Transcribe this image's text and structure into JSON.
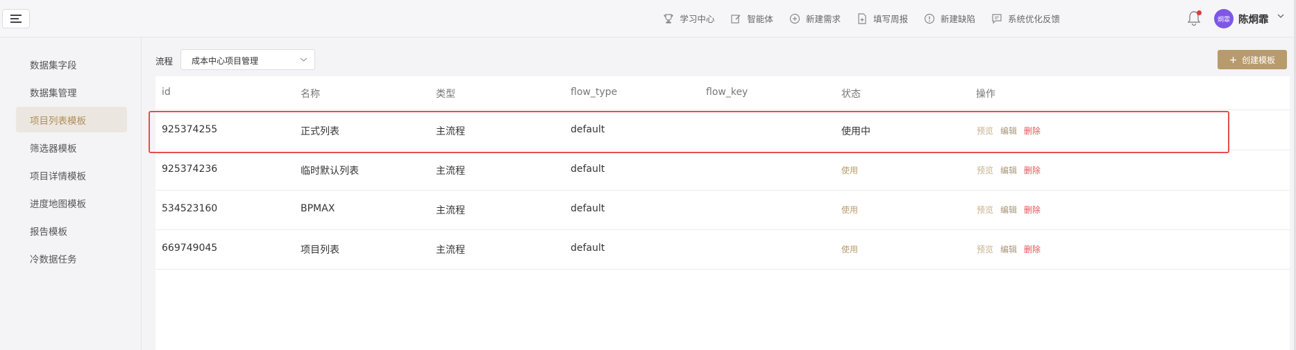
{
  "topbar": {
    "menu_icon": "menu-toggle-icon",
    "actions": [
      {
        "label": "学习中心",
        "icon": "trophy-icon"
      },
      {
        "label": "智能体",
        "icon": "edit-icon"
      },
      {
        "label": "新建需求",
        "icon": "plus-circle-icon"
      },
      {
        "label": "填写周报",
        "icon": "document-icon"
      },
      {
        "label": "新建缺陷",
        "icon": "alert-circle-icon"
      },
      {
        "label": "系统优化反馈",
        "icon": "message-icon"
      }
    ],
    "avatar_text": "炯霏",
    "user_name": "陈炯霏",
    "notification_dot_color": "#e5383b",
    "avatar_color": "#7e57e6"
  },
  "sidebar": {
    "items": [
      {
        "label": "数据集字段"
      },
      {
        "label": "数据集管理"
      },
      {
        "label": "项目列表模板",
        "active": true
      },
      {
        "label": "筛选器模板"
      },
      {
        "label": "项目详情模板"
      },
      {
        "label": "进度地图模板"
      },
      {
        "label": "报告模板"
      },
      {
        "label": "冷数据任务"
      }
    ],
    "active_color": "#b08d57"
  },
  "filter": {
    "label": "流程",
    "selected": "成本中心项目管理"
  },
  "create_button": {
    "label": "创建模板",
    "color": "#b89b6c"
  },
  "table": {
    "headers": [
      "id",
      "名称",
      "类型",
      "flow_type",
      "flow_key",
      "状态",
      "操作"
    ],
    "rows": [
      {
        "id": "925374255",
        "name": "正式列表",
        "type": "主流程",
        "flow_type": "default",
        "flow_key": "",
        "status": "使用中"
      },
      {
        "id": "925374236",
        "name": "临时默认列表",
        "type": "主流程",
        "flow_type": "default",
        "flow_key": "",
        "status": "使用"
      },
      {
        "id": "534523160",
        "name": "BPMAX",
        "type": "主流程",
        "flow_type": "default",
        "flow_key": "",
        "status": "使用"
      },
      {
        "id": "669749045",
        "name": "项目列表",
        "type": "主流程",
        "flow_type": "default",
        "flow_key": "",
        "status": "使用"
      }
    ],
    "ops": {
      "preview": "预览",
      "edit": "编辑",
      "delete": "删除"
    },
    "highlight_color": "#e84c50"
  }
}
